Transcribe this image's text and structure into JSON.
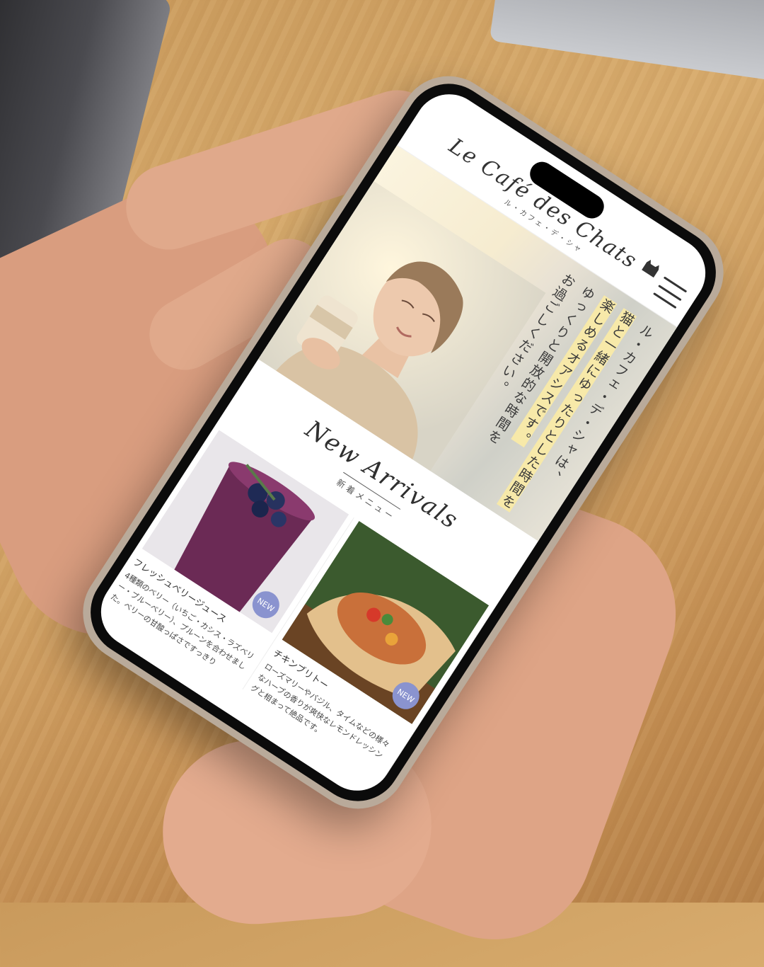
{
  "header": {
    "logo_main": "Le Café des Chats",
    "logo_sub": "ル・カフェ・デ・シャ"
  },
  "hero": {
    "line1": "ル・カフェ・デ・シャは、",
    "line2": "猫と一緒にゆったりとした時間を",
    "line3": "楽しめるオアシスです。",
    "line4": "ゆっくりと開放的な時間を",
    "line5": "お過ごしください。"
  },
  "section": {
    "title_en": "New Arrivals",
    "title_jp": "新着メニュー"
  },
  "items": [
    {
      "badge": "NEW",
      "title": "フレッシュベリージュース",
      "desc": "4種類のベリー（いちご・カシス・ラズベリー・ブルーベリー）、プルーンを合わせました。ベリーの甘酸っぱさですっきり"
    },
    {
      "badge": "NEW",
      "title": "チキンブリトー",
      "desc": "ローズマリーやバジル、タイムなどの様々なハーブの香りが爽快なレモンドレッシングと相まって絶品です。"
    }
  ],
  "colors": {
    "badge": "#8a93cf",
    "highlight": "#f7e9a9",
    "wood": "#d2a266"
  }
}
